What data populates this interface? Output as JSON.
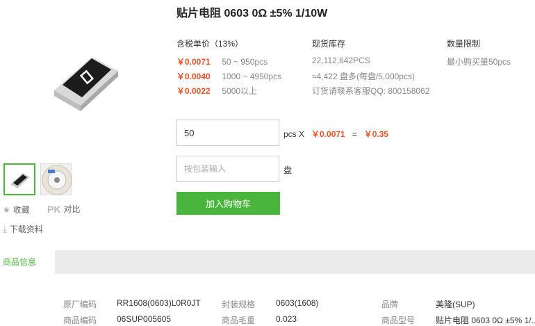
{
  "product": {
    "title": "贴片电阻 0603 0Ω ±5% 1/10W"
  },
  "gallery": {
    "main_image_alt": "resistor",
    "thumb_2_alt": "reel"
  },
  "actions": {
    "favorite": "收藏",
    "pk_mark": "PK",
    "compare": "对比",
    "download": "下载资料"
  },
  "pricing": {
    "price_header": "含税单价（13%）",
    "tiers": [
      {
        "price": "￥0.0071",
        "range": "50 ~ 950pcs"
      },
      {
        "price": "￥0.0040",
        "range": "1000 ~ 4950pcs"
      },
      {
        "price": "￥0.0022",
        "range": "5000以上"
      }
    ],
    "stock_header": "现货库存",
    "stock_lines": [
      "22,112,642PCS",
      "≈4,422 盘多(每盘/5,000pcs)",
      "订货请联系客服QQ: 800158062"
    ],
    "limit_header": "数量限制",
    "limit_text": "最小购买量50pcs"
  },
  "order": {
    "qty_value": "50",
    "unit_label": "pcs X",
    "unit_price": "￥0.0071",
    "equals": "=",
    "total": "￥0.35",
    "reel_placeholder": "按包装输入",
    "reel_unit": "盘",
    "add_to_cart": "加入购物车"
  },
  "tabs": {
    "active": "商品信息"
  },
  "info": {
    "rows": [
      [
        {
          "k": "原厂编码",
          "v": "RR1608(0603)L0R0JT"
        },
        {
          "k": "封装规格",
          "v": "0603(1608)"
        },
        {
          "k": "品牌",
          "v": "美隆(SUP)"
        }
      ],
      [
        {
          "k": "商品编码",
          "v": "06SUP005605"
        },
        {
          "k": "商品毛重",
          "v": "0.023"
        },
        {
          "k": "商品型号",
          "v": "贴片电阻 0603 0Ω ±5% 1/..."
        }
      ]
    ]
  }
}
